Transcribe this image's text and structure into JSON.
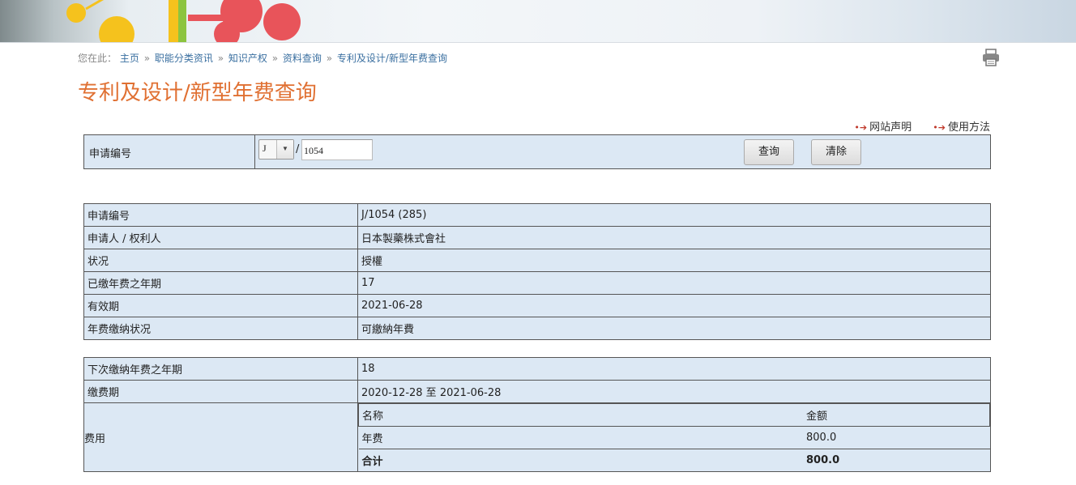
{
  "breadcrumb": {
    "prefix": "您在此：",
    "items": [
      "主页",
      "职能分类资讯",
      "知识产权",
      "资料查询",
      "专利及设计/新型年费查询"
    ],
    "sep": "»"
  },
  "page_title": "专利及设计/新型年费查询",
  "top_links": [
    "网站声明",
    "使用方法"
  ],
  "search": {
    "label": "申请编号",
    "prefix_value": "J",
    "number_value": "1054",
    "slash": "/",
    "query_button": "查询",
    "clear_button": "清除"
  },
  "record": [
    {
      "key": "申请编号",
      "value": "J/1054 (285)"
    },
    {
      "key": "申请人 / 权利人",
      "value": "日本製藥株式會社"
    },
    {
      "key": "状况",
      "value": "授權"
    },
    {
      "key": "已缴年费之年期",
      "value": "17"
    },
    {
      "key": "有效期",
      "value": "2021-06-28"
    },
    {
      "key": "年费缴纳状况",
      "value": "可繳納年費"
    }
  ],
  "next": [
    {
      "key": "下次缴纳年费之年期",
      "value": "18"
    },
    {
      "key": "缴费期",
      "value": "2020-12-28 至 2021-06-28"
    }
  ],
  "fees": {
    "label": "费用",
    "header": [
      "名称",
      "金额"
    ],
    "rows": [
      [
        "年费",
        "800.0"
      ]
    ],
    "total": [
      "合计",
      "800.0"
    ]
  },
  "colors": {
    "title": "#e07032",
    "table_bg": "#dce8f4",
    "link": "#3a6fa0"
  }
}
